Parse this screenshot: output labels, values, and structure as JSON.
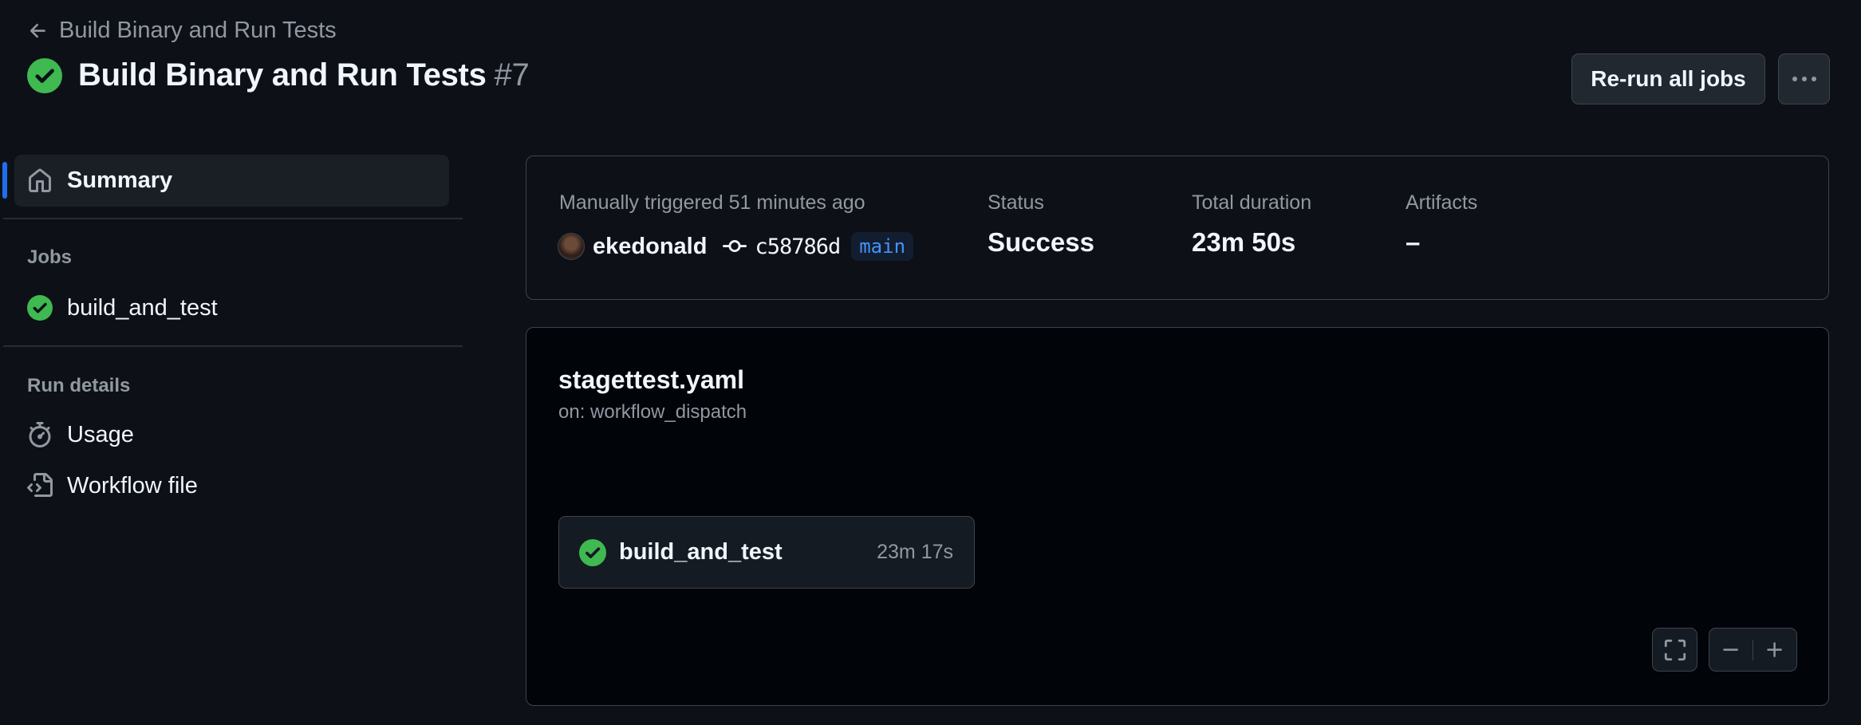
{
  "header": {
    "back_label": "Build Binary and Run Tests",
    "title": "Build Binary and Run Tests",
    "run_number": "#7",
    "rerun_label": "Re-run all jobs"
  },
  "sidebar": {
    "summary_label": "Summary",
    "jobs_heading": "Jobs",
    "jobs": [
      {
        "label": "build_and_test",
        "status": "success"
      }
    ],
    "run_details_heading": "Run details",
    "run_details": [
      {
        "label": "Usage",
        "icon": "stopwatch-icon"
      },
      {
        "label": "Workflow file",
        "icon": "file-code-icon"
      }
    ]
  },
  "summary": {
    "trigger_text": "Manually triggered 51 minutes ago",
    "actor": "ekedonald",
    "commit": "c58786d",
    "branch": "main",
    "status_label": "Status",
    "status_value": "Success",
    "duration_label": "Total duration",
    "duration_value": "23m 50s",
    "artifacts_label": "Artifacts",
    "artifacts_value": "–"
  },
  "graph": {
    "workflow_name": "stagettest.yaml",
    "trigger": "on: workflow_dispatch",
    "jobs": [
      {
        "name": "build_and_test",
        "duration": "23m 17s",
        "status": "success"
      }
    ]
  },
  "colors": {
    "background": "#0d1117",
    "success": "#3fb950",
    "accent": "#1f6feb",
    "muted_text": "#9198a1"
  }
}
